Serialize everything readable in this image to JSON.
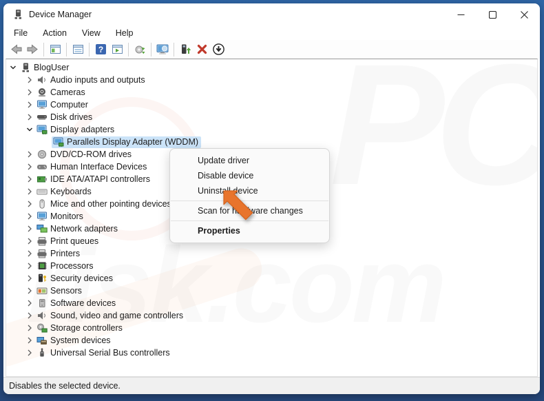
{
  "window": {
    "title": "Device Manager",
    "app_icon": "device-manager-icon",
    "controls": [
      {
        "name": "minimize",
        "icon": "minimize-icon"
      },
      {
        "name": "maximize",
        "icon": "maximize-icon"
      },
      {
        "name": "close",
        "icon": "close-icon"
      }
    ]
  },
  "menu_bar": {
    "items": [
      "File",
      "Action",
      "View",
      "Help"
    ]
  },
  "toolbar": {
    "buttons": [
      {
        "name": "back",
        "icon": "back-arrow-icon"
      },
      {
        "name": "forward",
        "icon": "forward-arrow-icon"
      },
      {
        "sep": true
      },
      {
        "name": "show-console-tree",
        "icon": "console-tree-icon"
      },
      {
        "sep": true
      },
      {
        "name": "properties-pane",
        "icon": "properties-window-icon"
      },
      {
        "sep": true
      },
      {
        "name": "help",
        "icon": "help-icon"
      },
      {
        "name": "action-pane",
        "icon": "action-pane-icon"
      },
      {
        "sep": true
      },
      {
        "name": "scan-for-hardware-changes",
        "icon": "scan-hardware-icon"
      },
      {
        "sep": true
      },
      {
        "name": "computer-search",
        "icon": "computer-search-icon"
      },
      {
        "sep": true
      },
      {
        "name": "update-driver",
        "icon": "update-driver-icon"
      },
      {
        "name": "uninstall-device",
        "icon": "uninstall-x-icon"
      },
      {
        "name": "disable-device",
        "icon": "disable-down-icon"
      }
    ]
  },
  "tree": {
    "rows": [
      {
        "label": "BlogUser",
        "icon": "computer-device-icon",
        "level": 0,
        "expanded": true
      },
      {
        "label": "Audio inputs and outputs",
        "icon": "speaker-icon",
        "level": 1
      },
      {
        "label": "Cameras",
        "icon": "camera-icon",
        "level": 1
      },
      {
        "label": "Computer",
        "icon": "monitor-icon",
        "level": 1
      },
      {
        "label": "Disk drives",
        "icon": "disk-drive-icon",
        "level": 1
      },
      {
        "label": "Display adapters",
        "icon": "display-adapter-icon",
        "level": 1,
        "expanded": true
      },
      {
        "label": "Parallels Display Adapter (WDDM)",
        "icon": "display-adapter-icon",
        "level": 2,
        "selected": true
      },
      {
        "label": "DVD/CD-ROM drives",
        "icon": "dvd-drive-icon",
        "level": 1
      },
      {
        "label": "Human Interface Devices",
        "icon": "hid-icon",
        "level": 1
      },
      {
        "label": "IDE ATA/ATAPI controllers",
        "icon": "ide-controller-icon",
        "level": 1
      },
      {
        "label": "Keyboards",
        "icon": "keyboard-icon",
        "level": 1
      },
      {
        "label": "Mice and other pointing devices",
        "icon": "mouse-icon",
        "level": 1
      },
      {
        "label": "Monitors",
        "icon": "monitor-icon",
        "level": 1
      },
      {
        "label": "Network adapters",
        "icon": "network-adapter-icon",
        "level": 1
      },
      {
        "label": "Print queues",
        "icon": "printer-icon",
        "level": 1
      },
      {
        "label": "Printers",
        "icon": "printer-icon",
        "level": 1
      },
      {
        "label": "Processors",
        "icon": "processor-icon",
        "level": 1
      },
      {
        "label": "Security devices",
        "icon": "security-device-icon",
        "level": 1
      },
      {
        "label": "Sensors",
        "icon": "sensor-icon",
        "level": 1
      },
      {
        "label": "Software devices",
        "icon": "software-device-icon",
        "level": 1
      },
      {
        "label": "Sound, video and game controllers",
        "icon": "speaker-icon",
        "level": 1
      },
      {
        "label": "Storage controllers",
        "icon": "storage-controller-icon",
        "level": 1
      },
      {
        "label": "System devices",
        "icon": "system-device-icon",
        "level": 1
      },
      {
        "label": "Universal Serial Bus controllers",
        "icon": "usb-icon",
        "level": 1
      }
    ]
  },
  "context_menu": {
    "items": [
      {
        "label": "Update driver"
      },
      {
        "label": "Disable device"
      },
      {
        "label": "Uninstall device"
      },
      {
        "sep": true
      },
      {
        "label": "Scan for hardware changes"
      },
      {
        "sep": true
      },
      {
        "label": "Properties",
        "bold": true
      }
    ]
  },
  "status_bar": {
    "text": "Disables the selected device."
  },
  "watermark": {
    "top": "PC",
    "bottom": "risk.com"
  },
  "colors": {
    "selection": "#cbe3f8",
    "desktop_top": "#2f66a7",
    "desktop_bottom": "#26477a",
    "status_bg": "#f0f0f0",
    "menu_bg": "#fafafa",
    "arrow_orange": "#e8742c",
    "uninstall_red": "#c0392b"
  }
}
